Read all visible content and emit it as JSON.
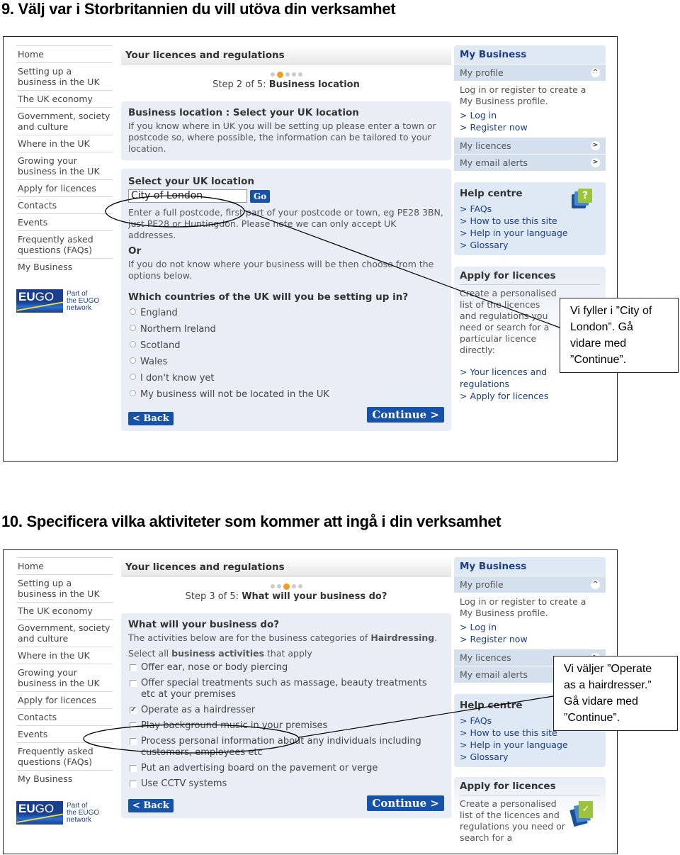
{
  "step9": {
    "heading": "9.  Välj var i Storbritannien du vill utöva din verksamhet",
    "callout": [
      "Vi fyller i ”City of",
      "London”. Gå",
      "vidare med",
      "”Continue”."
    ]
  },
  "step10": {
    "heading": "10.  Specificera vilka aktiviteter som kommer att ingå i din verksamhet",
    "callout": [
      "Vi väljer ”Operate",
      "as a hairdresser.”",
      "Gå vidare med",
      "”Continue”."
    ]
  },
  "leftnav": {
    "items": [
      "Home",
      "Setting up a business in the UK",
      "The UK economy",
      "Government, society and culture",
      "Where in the UK",
      "Growing your business in the UK",
      "Apply for licences",
      "Contacts",
      "Events",
      "Frequently asked questions (FAQs)",
      "My Business"
    ],
    "logo_text": "EU",
    "logo_text2": "GO",
    "logo_caption": [
      "Part of",
      "the EUGO",
      "network"
    ]
  },
  "main": {
    "header": "Your licences and regulations",
    "back": "< Back",
    "continue": "Continue >"
  },
  "form1": {
    "step_prefix": "Step 2 of 5: ",
    "step_name": "Business location",
    "step_index": 2,
    "step_total": 5,
    "title": "Business location : Select your UK location",
    "intro": "If you know where in UK you will be setting up please enter a town or postcode so, where possible, the information can be tailored to your location.",
    "select_label": "Select your UK location",
    "location_value": "City of London",
    "go": "Go",
    "hint": "Enter a full postcode, first part of your postcode or town, eg PE28 3BN, just PE28 or Huntingdon. Please note we can only accept UK addresses.",
    "or": "Or",
    "or_text": "If you do not know where your business will be then choose from the options below.",
    "question": "Which countries of the UK will you be setting up in?",
    "options": [
      "England",
      "Northern Ireland",
      "Scotland",
      "Wales",
      "I don't know yet",
      "My business will not be located in the UK"
    ]
  },
  "form2": {
    "step_prefix": "Step 3 of 5: ",
    "step_name": "What will your business do?",
    "step_index": 3,
    "step_total": 5,
    "title": "What will your business do?",
    "intro_a": "The activities below are for the business categories of ",
    "intro_b": "Hairdressing",
    "intro_c": ".",
    "select_a": "Select all ",
    "select_b": "business activities",
    "select_c": " that apply",
    "activities": [
      {
        "label": "Offer ear, nose or body piercing",
        "checked": false
      },
      {
        "label": "Offer special treatments such as massage, beauty treatments etc at your premises",
        "checked": false
      },
      {
        "label": "Operate as a hairdresser",
        "checked": true
      },
      {
        "label": "Play background music in your premises",
        "checked": false
      },
      {
        "label": "Process personal information about any individuals including customers, employees etc",
        "checked": false
      },
      {
        "label": "Put an advertising board on the pavement or verge",
        "checked": false
      },
      {
        "label": "Use CCTV systems",
        "checked": false
      }
    ]
  },
  "sidebar": {
    "my_business": "My Business",
    "my_profile": "My profile",
    "profile_text": "Log in or register to create a My Business profile.",
    "login": "> Log in",
    "register": "> Register now",
    "my_licences": "My licences",
    "email_alerts": "My email alerts",
    "help_title": "Help centre",
    "help_links": [
      "> FAQs",
      "> How to use this site",
      "> Help in your language",
      "> Glossary"
    ],
    "apply_title": "Apply for licences",
    "apply_text": "Create a personalised list of the licences and regulations you need or search for a particular licence directly:",
    "apply_text_short": "Create a personalised list of the licences and regulations you need or search for a",
    "apply_links": [
      "> Your licences and regulations",
      "> Apply for licences"
    ]
  },
  "colors": {
    "accent": "#1552a8",
    "step_active": "#f0a020",
    "panel": "#e8edf6",
    "link": "#1c3e86"
  }
}
